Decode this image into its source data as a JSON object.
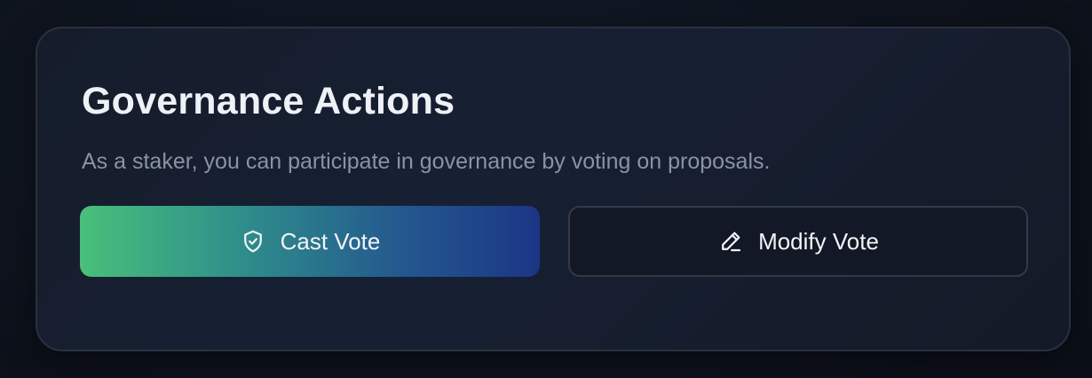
{
  "card": {
    "title": "Governance Actions",
    "subtitle": "As a staker, you can participate in governance by voting on proposals."
  },
  "actions": {
    "cast_vote": {
      "label": "Cast Vote",
      "icon": "shield-check-icon"
    },
    "modify_vote": {
      "label": "Modify Vote",
      "icon": "pencil-icon"
    }
  },
  "colors": {
    "gradient_start": "#48c07a",
    "gradient_end": "#1b3585",
    "card_background": "#172033",
    "title_text": "#eef1f5",
    "subtitle_text": "#8a93a3"
  }
}
